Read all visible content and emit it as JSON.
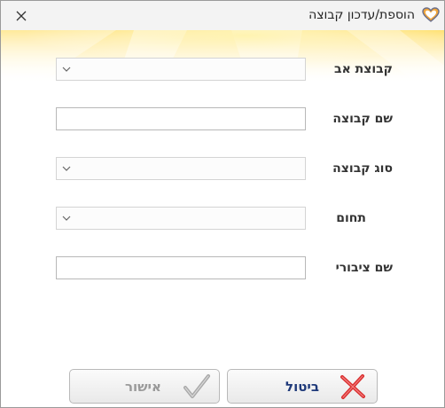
{
  "window": {
    "title": "הוספת/עדכון קבוצה",
    "close_icon": "close-icon",
    "app_icon": "heart-logo-icon"
  },
  "form": {
    "fields": [
      {
        "label": "קבוצת אב",
        "type": "combo",
        "value": ""
      },
      {
        "label": "שם קבוצה",
        "type": "text",
        "value": ""
      },
      {
        "label": "סוג קבוצה",
        "type": "combo",
        "value": ""
      },
      {
        "label": "תחום",
        "type": "combo",
        "value": ""
      },
      {
        "label": "שם ציבורי",
        "type": "text",
        "value": ""
      }
    ]
  },
  "buttons": {
    "cancel_label": "ביטול",
    "cancel_icon": "red-x-icon",
    "ok_label": "אישור",
    "ok_icon": "checkmark-icon"
  },
  "colors": {
    "banner_accent": "#ffd84a",
    "cancel_text": "#1f3a7a",
    "ok_text": "#9a9a9a",
    "cancel_icon": "#d93030"
  }
}
